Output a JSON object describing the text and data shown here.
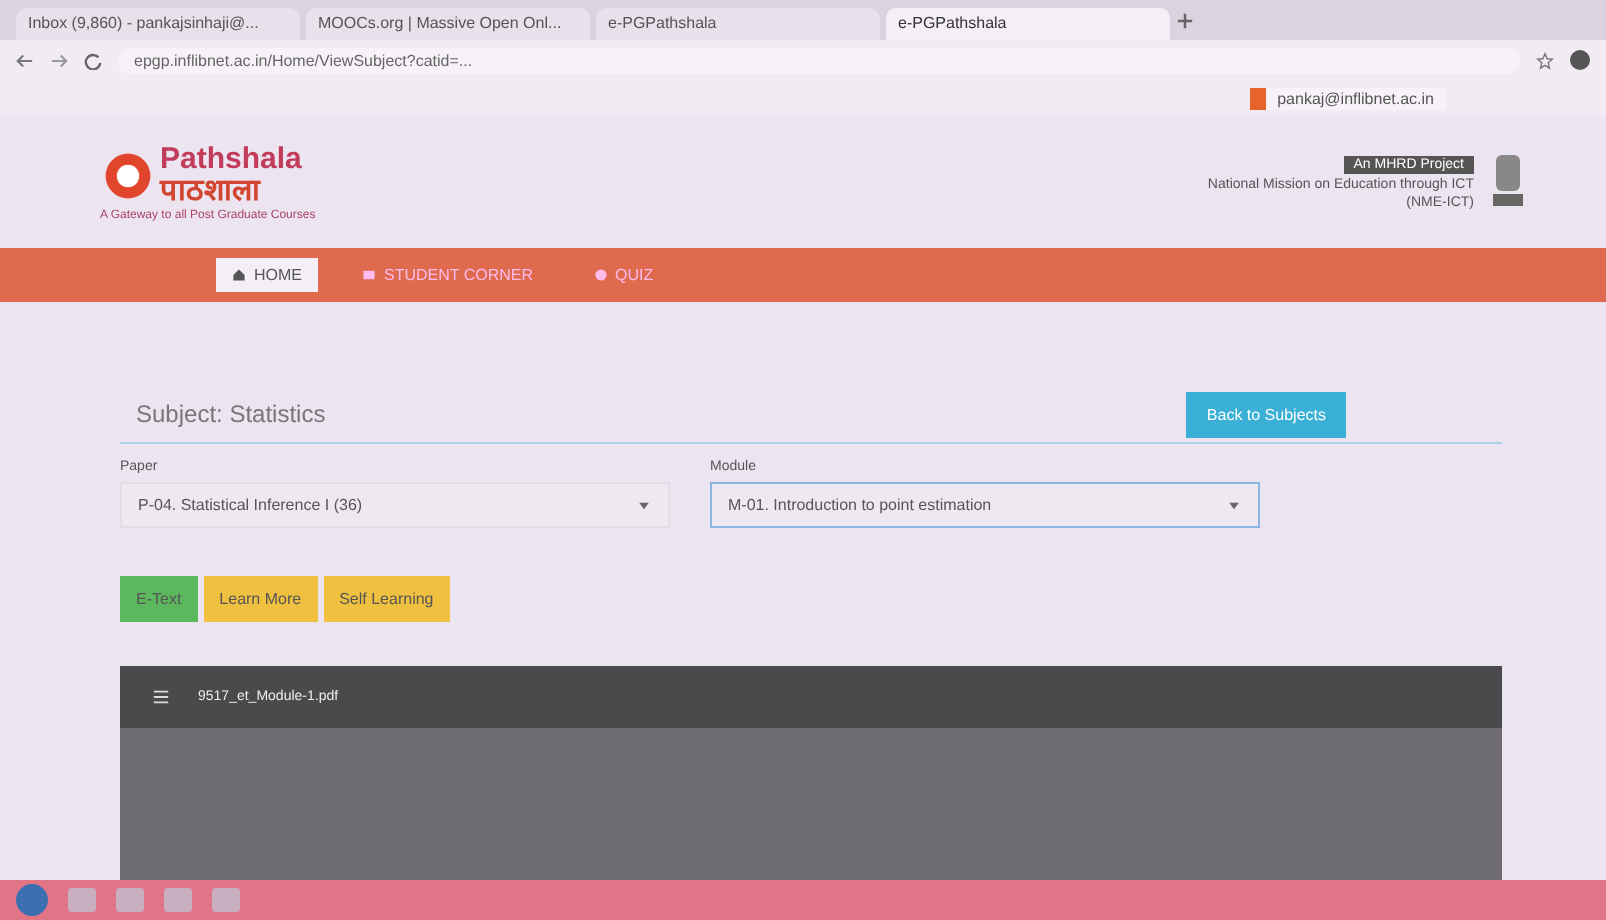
{
  "browser": {
    "tabs": [
      {
        "title": "Inbox (9,860) - pankajsinhaji@...",
        "selected": false
      },
      {
        "title": "MOOCs.org | Massive Open Onl...",
        "selected": false
      },
      {
        "title": "e-PGPathshala",
        "selected": false
      },
      {
        "title": "e-PGPathshala",
        "selected": true
      }
    ],
    "url": "epgp.inflibnet.ac.in/Home/ViewSubject?catid=...",
    "profile_chip": "pankaj@inflibnet.ac.in"
  },
  "header": {
    "logo_latin": "Pathshala",
    "logo_hindi": "पाठशाला",
    "tagline": "A Gateway to all Post Graduate Courses",
    "project_badge": "An MHRD Project",
    "mission": "National Mission on Education through ICT",
    "mission_short": "(NME-ICT)"
  },
  "nav": [
    {
      "label": "HOME",
      "selected": true
    },
    {
      "label": "STUDENT CORNER",
      "selected": false
    },
    {
      "label": "QUIZ",
      "selected": false
    }
  ],
  "subject": {
    "title": "Subject: Statistics",
    "back_button": "Back to Subjects"
  },
  "selectors": [
    {
      "label": "Paper",
      "value": "P-04. Statistical Inference I (36)",
      "focused": false
    },
    {
      "label": "Module",
      "value": "M-01. Introduction to point estimation",
      "focused": true
    }
  ],
  "actions": [
    {
      "label": "E-Text",
      "color": "#5cb85c"
    },
    {
      "label": "Learn More",
      "color": "#f0c040"
    },
    {
      "label": "Self Learning",
      "color": "#f0c040"
    }
  ],
  "viewer": {
    "file_name": "9517_et_Module-1.pdf"
  }
}
